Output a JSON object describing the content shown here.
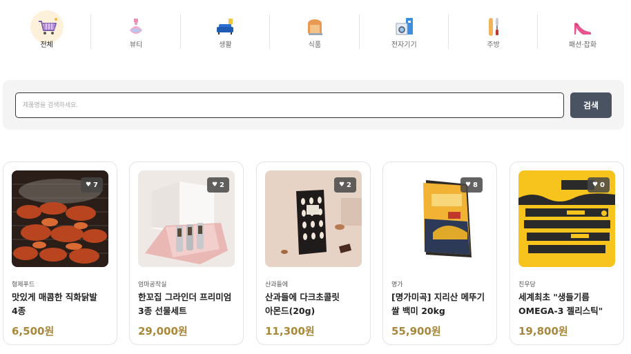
{
  "categories": [
    {
      "label": "전체",
      "icon": "shopping-cart-icon",
      "active": true
    },
    {
      "label": "뷰티",
      "icon": "perfume-bottle-icon",
      "active": false
    },
    {
      "label": "생활",
      "icon": "sofa-icon",
      "active": false
    },
    {
      "label": "식품",
      "icon": "bread-icon",
      "active": false
    },
    {
      "label": "전자기기",
      "icon": "washing-machine-icon",
      "active": false
    },
    {
      "label": "주방",
      "icon": "kitchen-tools-icon",
      "active": false
    },
    {
      "label": "패션·잡화",
      "icon": "high-heel-icon",
      "active": false
    }
  ],
  "search": {
    "placeholder": "제품명을 검색하세요.",
    "value": "",
    "button_label": "검색"
  },
  "products": [
    {
      "brand": "형제푸드",
      "name": "맛있게 매콤한 직화닭발 4종",
      "price": "6,500원",
      "likes": "7",
      "image": "grilled-chicken-feet-photo"
    },
    {
      "brand": "엄마공작실",
      "name": "한꼬집 그라인더 프리미엄 3종 선물세트",
      "price": "29,000원",
      "likes": "2",
      "image": "grinder-gift-set-photo"
    },
    {
      "brand": "산과들에",
      "name": "산과들에 다크초콜릿 아몬드(20g)",
      "price": "11,300원",
      "likes": "2",
      "image": "dark-chocolate-almond-photo"
    },
    {
      "brand": "명가",
      "name": "[명가미곡] 지리산 메뚜기 쌀 백미 20kg",
      "price": "55,900원",
      "likes": "8",
      "image": "rice-bag-photo"
    },
    {
      "brand": "친우당",
      "name": "세계최초 \"생들기름 OMEGA-3 젤리스틱\"",
      "price": "19,800원",
      "likes": "0",
      "image": "perilla-oil-jelly-stick-photo"
    }
  ],
  "colors": {
    "price": "#a8873a",
    "search_button": "#4a5361",
    "search_panel": "#f4f4f4",
    "active_category_bg": "#fdf1dc"
  }
}
